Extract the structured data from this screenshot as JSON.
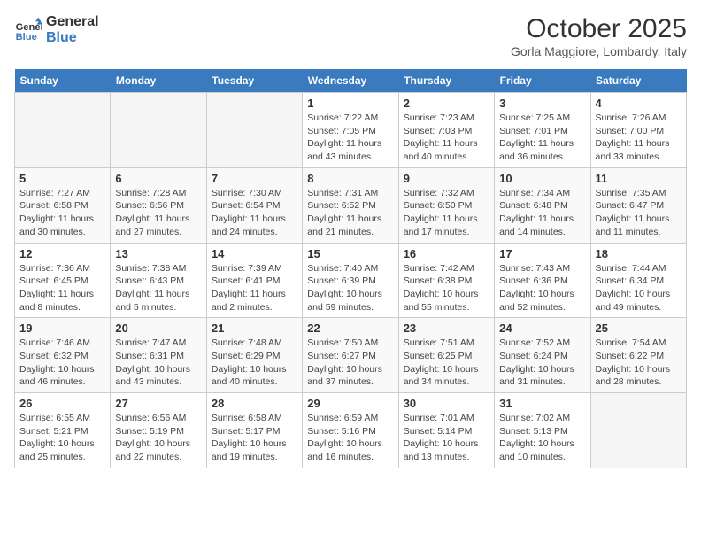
{
  "header": {
    "logo_line1": "General",
    "logo_line2": "Blue",
    "month": "October 2025",
    "location": "Gorla Maggiore, Lombardy, Italy"
  },
  "weekdays": [
    "Sunday",
    "Monday",
    "Tuesday",
    "Wednesday",
    "Thursday",
    "Friday",
    "Saturday"
  ],
  "weeks": [
    [
      {
        "day": "",
        "info": ""
      },
      {
        "day": "",
        "info": ""
      },
      {
        "day": "",
        "info": ""
      },
      {
        "day": "1",
        "info": "Sunrise: 7:22 AM\nSunset: 7:05 PM\nDaylight: 11 hours\nand 43 minutes."
      },
      {
        "day": "2",
        "info": "Sunrise: 7:23 AM\nSunset: 7:03 PM\nDaylight: 11 hours\nand 40 minutes."
      },
      {
        "day": "3",
        "info": "Sunrise: 7:25 AM\nSunset: 7:01 PM\nDaylight: 11 hours\nand 36 minutes."
      },
      {
        "day": "4",
        "info": "Sunrise: 7:26 AM\nSunset: 7:00 PM\nDaylight: 11 hours\nand 33 minutes."
      }
    ],
    [
      {
        "day": "5",
        "info": "Sunrise: 7:27 AM\nSunset: 6:58 PM\nDaylight: 11 hours\nand 30 minutes."
      },
      {
        "day": "6",
        "info": "Sunrise: 7:28 AM\nSunset: 6:56 PM\nDaylight: 11 hours\nand 27 minutes."
      },
      {
        "day": "7",
        "info": "Sunrise: 7:30 AM\nSunset: 6:54 PM\nDaylight: 11 hours\nand 24 minutes."
      },
      {
        "day": "8",
        "info": "Sunrise: 7:31 AM\nSunset: 6:52 PM\nDaylight: 11 hours\nand 21 minutes."
      },
      {
        "day": "9",
        "info": "Sunrise: 7:32 AM\nSunset: 6:50 PM\nDaylight: 11 hours\nand 17 minutes."
      },
      {
        "day": "10",
        "info": "Sunrise: 7:34 AM\nSunset: 6:48 PM\nDaylight: 11 hours\nand 14 minutes."
      },
      {
        "day": "11",
        "info": "Sunrise: 7:35 AM\nSunset: 6:47 PM\nDaylight: 11 hours\nand 11 minutes."
      }
    ],
    [
      {
        "day": "12",
        "info": "Sunrise: 7:36 AM\nSunset: 6:45 PM\nDaylight: 11 hours\nand 8 minutes."
      },
      {
        "day": "13",
        "info": "Sunrise: 7:38 AM\nSunset: 6:43 PM\nDaylight: 11 hours\nand 5 minutes."
      },
      {
        "day": "14",
        "info": "Sunrise: 7:39 AM\nSunset: 6:41 PM\nDaylight: 11 hours\nand 2 minutes."
      },
      {
        "day": "15",
        "info": "Sunrise: 7:40 AM\nSunset: 6:39 PM\nDaylight: 10 hours\nand 59 minutes."
      },
      {
        "day": "16",
        "info": "Sunrise: 7:42 AM\nSunset: 6:38 PM\nDaylight: 10 hours\nand 55 minutes."
      },
      {
        "day": "17",
        "info": "Sunrise: 7:43 AM\nSunset: 6:36 PM\nDaylight: 10 hours\nand 52 minutes."
      },
      {
        "day": "18",
        "info": "Sunrise: 7:44 AM\nSunset: 6:34 PM\nDaylight: 10 hours\nand 49 minutes."
      }
    ],
    [
      {
        "day": "19",
        "info": "Sunrise: 7:46 AM\nSunset: 6:32 PM\nDaylight: 10 hours\nand 46 minutes."
      },
      {
        "day": "20",
        "info": "Sunrise: 7:47 AM\nSunset: 6:31 PM\nDaylight: 10 hours\nand 43 minutes."
      },
      {
        "day": "21",
        "info": "Sunrise: 7:48 AM\nSunset: 6:29 PM\nDaylight: 10 hours\nand 40 minutes."
      },
      {
        "day": "22",
        "info": "Sunrise: 7:50 AM\nSunset: 6:27 PM\nDaylight: 10 hours\nand 37 minutes."
      },
      {
        "day": "23",
        "info": "Sunrise: 7:51 AM\nSunset: 6:25 PM\nDaylight: 10 hours\nand 34 minutes."
      },
      {
        "day": "24",
        "info": "Sunrise: 7:52 AM\nSunset: 6:24 PM\nDaylight: 10 hours\nand 31 minutes."
      },
      {
        "day": "25",
        "info": "Sunrise: 7:54 AM\nSunset: 6:22 PM\nDaylight: 10 hours\nand 28 minutes."
      }
    ],
    [
      {
        "day": "26",
        "info": "Sunrise: 6:55 AM\nSunset: 5:21 PM\nDaylight: 10 hours\nand 25 minutes."
      },
      {
        "day": "27",
        "info": "Sunrise: 6:56 AM\nSunset: 5:19 PM\nDaylight: 10 hours\nand 22 minutes."
      },
      {
        "day": "28",
        "info": "Sunrise: 6:58 AM\nSunset: 5:17 PM\nDaylight: 10 hours\nand 19 minutes."
      },
      {
        "day": "29",
        "info": "Sunrise: 6:59 AM\nSunset: 5:16 PM\nDaylight: 10 hours\nand 16 minutes."
      },
      {
        "day": "30",
        "info": "Sunrise: 7:01 AM\nSunset: 5:14 PM\nDaylight: 10 hours\nand 13 minutes."
      },
      {
        "day": "31",
        "info": "Sunrise: 7:02 AM\nSunset: 5:13 PM\nDaylight: 10 hours\nand 10 minutes."
      },
      {
        "day": "",
        "info": ""
      }
    ]
  ]
}
